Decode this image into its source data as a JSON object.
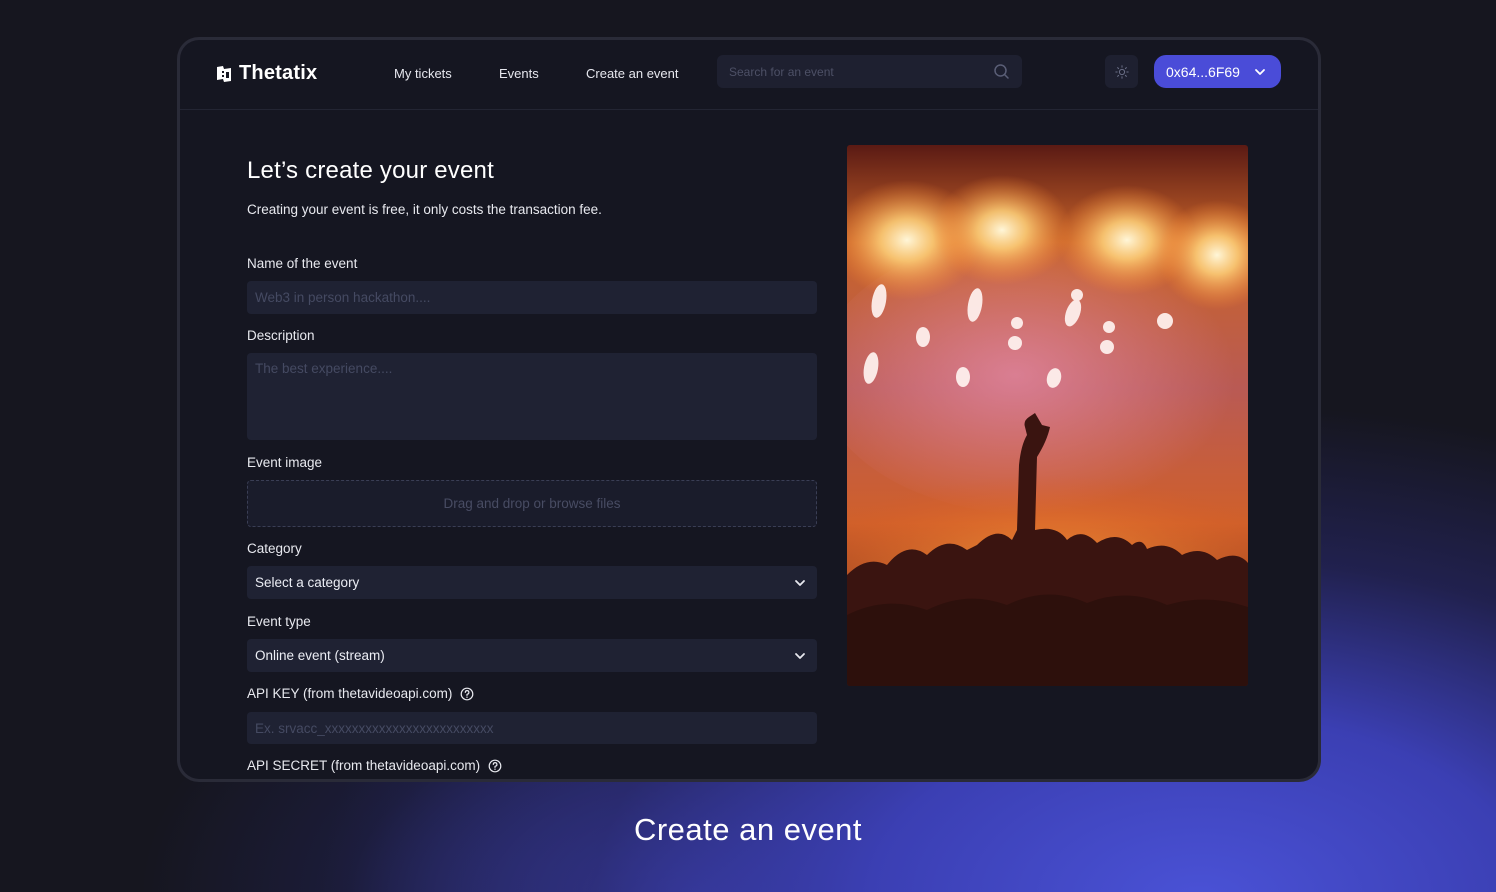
{
  "navbar": {
    "brand": "Thetatix",
    "links": [
      "My tickets",
      "Events",
      "Create an event"
    ],
    "search_placeholder": "Search for an event",
    "wallet_label": "0x64...6F69",
    "icons": {
      "brand": "ticket-logo-icon",
      "search": "search-icon",
      "theme": "sun-icon",
      "wallet_dropdown": "chevron-down-icon"
    }
  },
  "form": {
    "title": "Let’s create your event",
    "subtitle": "Creating your event is free, it only costs the transaction fee.",
    "name_label": "Name of the event",
    "name_placeholder": "Web3 in person hackathon....",
    "description_label": "Description",
    "description_placeholder": "The best experience....",
    "image_label": "Event image",
    "image_dropzone": "Drag and drop or browse files",
    "category_label": "Category",
    "category_value": "Select a category",
    "type_label": "Event type",
    "type_value": "Online event (stream)",
    "api_key_label": "API KEY (from thetavideoapi.com)",
    "api_key_placeholder": "Ex. srvacc_xxxxxxxxxxxxxxxxxxxxxxxxx",
    "api_secret_label": "API SECRET (from thetavideoapi.com)"
  },
  "colors": {
    "accent": "#4a4cd8",
    "background": "#151621",
    "field": "#1f2233"
  },
  "caption": "Create an event"
}
